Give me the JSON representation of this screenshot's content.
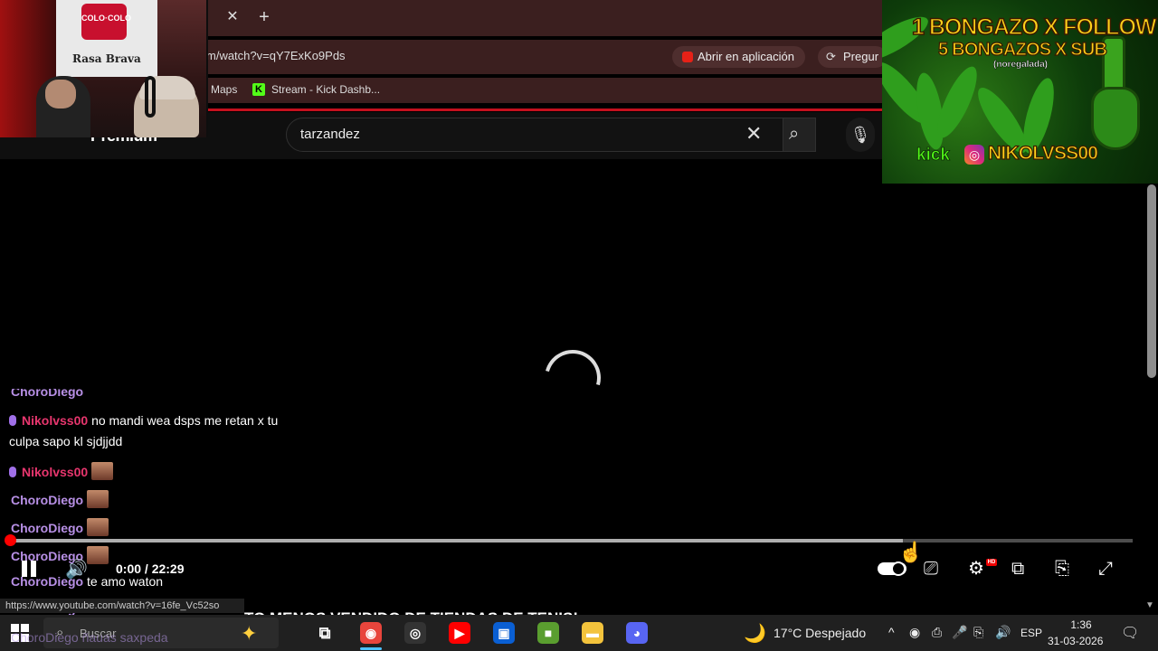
{
  "browser": {
    "tab_close": "✕",
    "new_tab": "+",
    "url": "m/watch?v=qY7ExKo9Pds",
    "open_app": "Abrir en aplicación",
    "ask": "Pregur",
    "bookmarks": [
      {
        "label": "Maps"
      },
      {
        "label": "Stream - Kick Dashb...",
        "icon_text": "K"
      }
    ]
  },
  "youtube": {
    "logo_text": "Premium",
    "search_value": "tarzandez",
    "clear_icon": "✕",
    "search_icon": "⌕",
    "mic_icon": "🎙"
  },
  "webcam": {
    "badge_text": "COLO·COLO",
    "shirt_text": "Rasa Brava"
  },
  "promo": {
    "line1": "1 BONGAZO X FOLLOW",
    "line2": "5 BONGAZOS X SUB",
    "line3": "(noregalada)",
    "kick": "kick",
    "ig_icon": "◎",
    "handle": "NIKOLVSS00"
  },
  "chat": [
    {
      "user": "ChoroDiego",
      "text": ""
    },
    {
      "user": "Nikolvss00",
      "text": "no mandi wea dsps me retan x tu",
      "text2": "culpa sapo kl sjdjjdd"
    },
    {
      "user": "Nikolvss00",
      "text": ""
    },
    {
      "user": "ChoroDiego",
      "text": ""
    },
    {
      "user": "ChoroDiego",
      "text": ""
    },
    {
      "user": "ChoroDiego",
      "text": ""
    },
    {
      "user": "ChoroDiego",
      "text": "te amo waton"
    },
    {
      "user": "ChoroDiego",
      "text": ""
    },
    {
      "user": "ChoroDiego",
      "text": "ñauas saxpeda"
    }
  ],
  "player": {
    "time": "0:00 / 22:29",
    "progress_played": 0.0,
    "volume_icon": "🔊",
    "subtitles_icon": "⎚",
    "settings_icon": "⚙",
    "hd_badge": "HD",
    "miniplayer_icon": "⧉",
    "cast_icon": "⎘",
    "fullscreen_icon": "⤢"
  },
  "status_url": "https://www.youtube.com/watch?v=16fe_Vc52so",
  "next_title": "TO MENOS VENDIDO DE TIENDAS DE TENIS!",
  "taskbar": {
    "search_placeholder": "Buscar",
    "search_icon": "⌕",
    "copilot_icon": "✦",
    "taskview_icon": "⧉",
    "apps": [
      {
        "name": "chrome",
        "glyph": "◉",
        "color": "#e8453c"
      },
      {
        "name": "obs",
        "glyph": "◎",
        "color": "#333333"
      },
      {
        "name": "youtube",
        "glyph": "▶",
        "color": "#ff0000"
      },
      {
        "name": "store",
        "glyph": "▣",
        "color": "#0a5fd3"
      },
      {
        "name": "minecraft",
        "glyph": "■",
        "color": "#5a9e2f"
      },
      {
        "name": "explorer",
        "glyph": "▬",
        "color": "#f3c33c"
      },
      {
        "name": "discord",
        "glyph": "◕",
        "color": "#5865f2"
      }
    ],
    "weather_icon": "🌙",
    "weather": "17°C  Despejado",
    "tray_up": "^",
    "tray_icons": [
      "◉",
      "⎙",
      "🎤",
      "⎘",
      "🔊"
    ],
    "lang": "ESP",
    "time": "1:36",
    "date": "31-03-2026",
    "notif_icon": "🗨"
  }
}
